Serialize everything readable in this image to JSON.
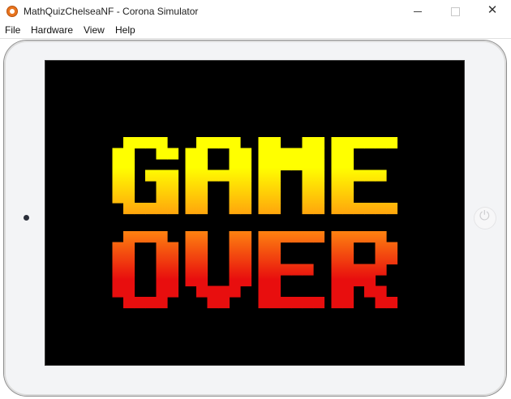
{
  "window": {
    "title": "MathQuizChelseaNF - Corona Simulator",
    "controls": {
      "minimize_icon": "minimize-icon",
      "maximize_icon": "maximize-icon",
      "close_glyph": "✕"
    }
  },
  "menu": {
    "items": [
      {
        "label": "File"
      },
      {
        "label": "Hardware"
      },
      {
        "label": "View"
      },
      {
        "label": "Help"
      }
    ]
  },
  "game": {
    "line1": "GAME",
    "line2": "OVER",
    "colors": {
      "top": "#ffff00",
      "middle": "#ff8c10",
      "bottom": "#e80e0e",
      "background": "#000000"
    }
  },
  "device": {
    "home_glyph": "⏻"
  }
}
